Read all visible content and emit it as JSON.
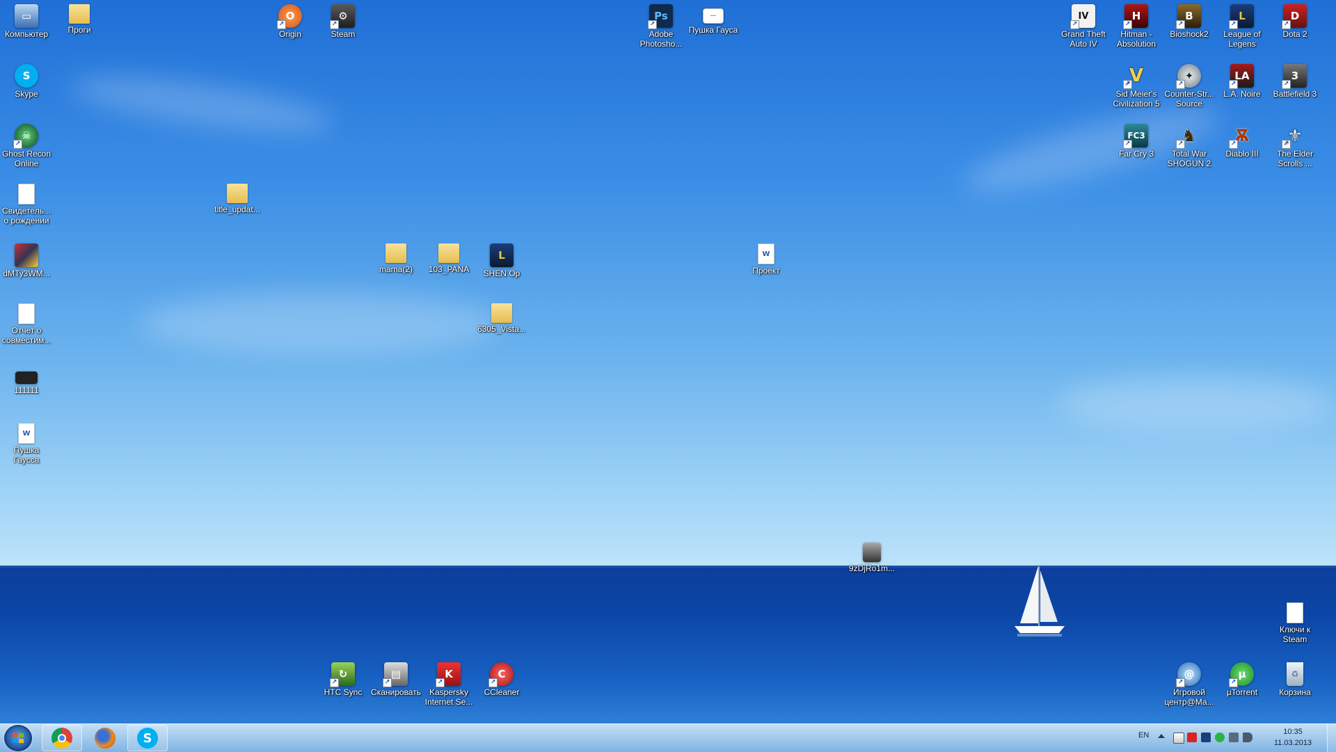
{
  "desktop": {
    "icons": [
      {
        "label": "Компьютер",
        "icon": "computer-icon"
      },
      {
        "label": "Проги",
        "icon": "folder-icon"
      },
      {
        "label": "Origin",
        "icon": "origin-icon"
      },
      {
        "label": "Steam",
        "icon": "steam-icon"
      },
      {
        "label": "Adobe Photosho...",
        "icon": "photoshop-icon"
      },
      {
        "label": "Пушка Гауса",
        "icon": "file-icon"
      },
      {
        "label": "Grand Theft Auto IV",
        "icon": "gta-icon"
      },
      {
        "label": "Hitman - Absolution",
        "icon": "hitman-icon"
      },
      {
        "label": "Bioshock2",
        "icon": "bioshock-icon"
      },
      {
        "label": "League of Legens",
        "icon": "league-icon"
      },
      {
        "label": "Dota 2",
        "icon": "dota-icon"
      },
      {
        "label": "Skype",
        "icon": "skype-icon"
      },
      {
        "label": "Sid Meier's Civilization 5",
        "icon": "civilization-icon"
      },
      {
        "label": "Counter-Str... Source",
        "icon": "counter-strike-icon"
      },
      {
        "label": "L.A. Noire",
        "icon": "la-noire-icon"
      },
      {
        "label": "Battlefield 3",
        "icon": "battlefield-icon"
      },
      {
        "label": "Ghost Recon Online",
        "icon": "ghost-recon-icon"
      },
      {
        "label": "Far Cry 3",
        "icon": "far-cry-icon"
      },
      {
        "label": "Total War SHOGUN 2",
        "icon": "shogun-icon"
      },
      {
        "label": "Diablo III",
        "icon": "diablo-icon"
      },
      {
        "label": "The Elder Scrolls ...",
        "icon": "elder-scrolls-icon"
      },
      {
        "label": "Свидетель... о рождении",
        "icon": "document-icon"
      },
      {
        "label": "title_updat...",
        "icon": "folder-icon"
      },
      {
        "label": "dMTy3WM...",
        "icon": "image-icon"
      },
      {
        "label": "mama(2)",
        "icon": "folder-icon"
      },
      {
        "label": "103_PANA",
        "icon": "folder-icon"
      },
      {
        "label": "SHEN Op",
        "icon": "league-icon"
      },
      {
        "label": "Проект",
        "icon": "word-document-icon"
      },
      {
        "label": "Отчет о совместим...",
        "icon": "file-icon"
      },
      {
        "label": "6305_Vista...",
        "icon": "folder-icon"
      },
      {
        "label": "111111",
        "icon": "image-icon"
      },
      {
        "label": "Пушка Гаусса",
        "icon": "word-document-icon"
      },
      {
        "label": "9zDjRo1m...",
        "icon": "image-icon"
      },
      {
        "label": "Ключи к Steam",
        "icon": "file-icon"
      },
      {
        "label": "HTC Sync",
        "icon": "htc-sync-icon"
      },
      {
        "label": "Сканировать",
        "icon": "scanner-icon"
      },
      {
        "label": "Kaspersky Internet Se...",
        "icon": "kaspersky-icon"
      },
      {
        "label": "CCleaner",
        "icon": "ccleaner-icon"
      },
      {
        "label": "Игровой центр@Ма...",
        "icon": "game-center-icon"
      },
      {
        "label": "µTorrent",
        "icon": "utorrent-icon"
      },
      {
        "label": "Корзина",
        "icon": "recycle-bin-icon"
      }
    ]
  },
  "taskbar": {
    "apps": [
      "chrome-icon",
      "firefox-icon",
      "skype-icon"
    ],
    "tray": {
      "language": "EN",
      "time": "10:35",
      "date": "11.03.2013"
    }
  },
  "colors": {
    "sky_top": "#1f6fd6",
    "sea": "#0d3e9c",
    "taskbar": "#8fc0ea"
  }
}
